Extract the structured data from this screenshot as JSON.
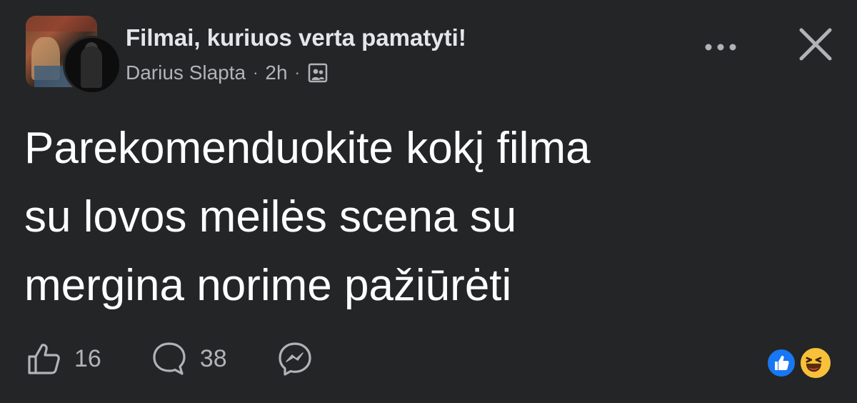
{
  "header": {
    "group_name": "Filmai, kuriuos verta pamatyti!",
    "author": "Darius Slapta",
    "separator": "·",
    "time": "2h",
    "audience_icon": "group-audience-icon"
  },
  "post": {
    "text": "Parekomenduokite kokį filma\nsu  lovos meilės scena su\nmergina norime pažiūrėti"
  },
  "actions": {
    "like_count": "16",
    "comment_count": "38"
  },
  "reactions": [
    "like",
    "haha"
  ],
  "colors": {
    "background": "#242526",
    "text_primary": "#ffffff",
    "text_secondary": "#b0b3b8",
    "like_blue": "#1877f2",
    "haha_yellow": "#f7c23a"
  }
}
